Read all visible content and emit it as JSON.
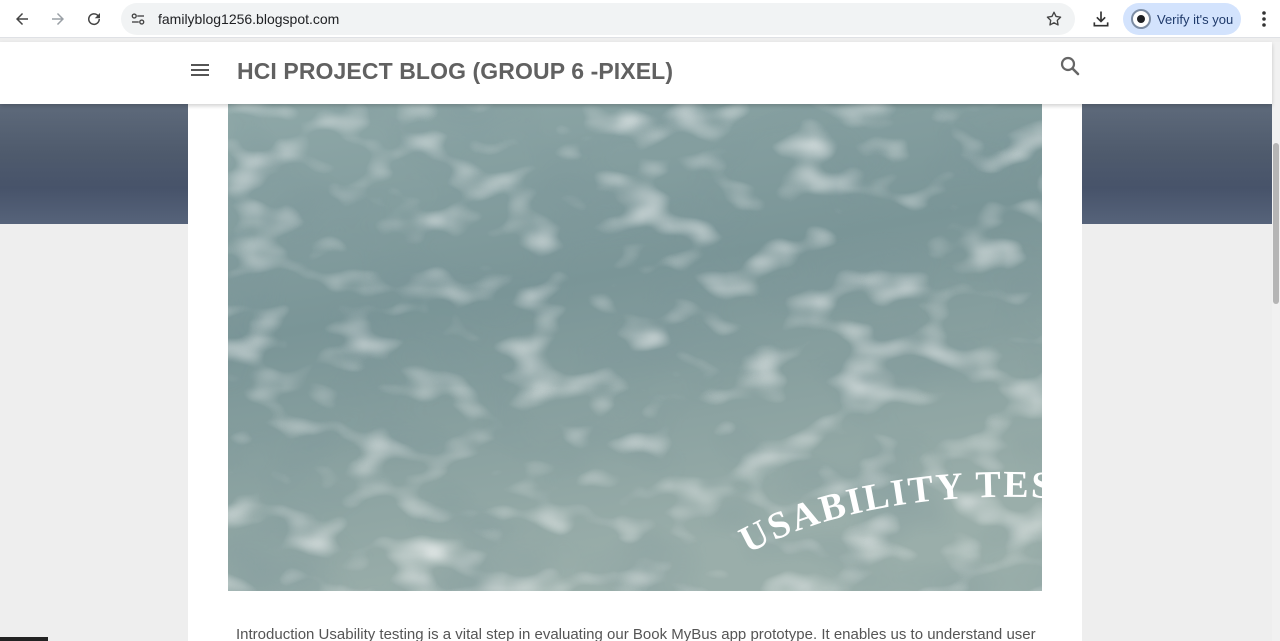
{
  "browser": {
    "url": "familyblog1256.blogspot.com",
    "verify_label": "Verify it's you",
    "icons": [
      "back-icon",
      "forward-icon",
      "reload-icon",
      "site-settings-icon",
      "bookmark-star-icon",
      "download-icon",
      "more-menu-icon"
    ]
  },
  "blog": {
    "title": "HCI PROJECT BLOG (GROUP 6 -PIXEL)",
    "icons": [
      "hamburger-menu-icon",
      "search-icon"
    ]
  },
  "post": {
    "hero_caption": "USABILITY TESTI",
    "intro_text": "Introduction Usability testing is a vital step in evaluating our Book MyBus app prototype. It enables us to understand user"
  },
  "colors": {
    "title_gray": "#616161",
    "verify_bg": "#d3e3fd",
    "water": "#7f9a9c"
  }
}
